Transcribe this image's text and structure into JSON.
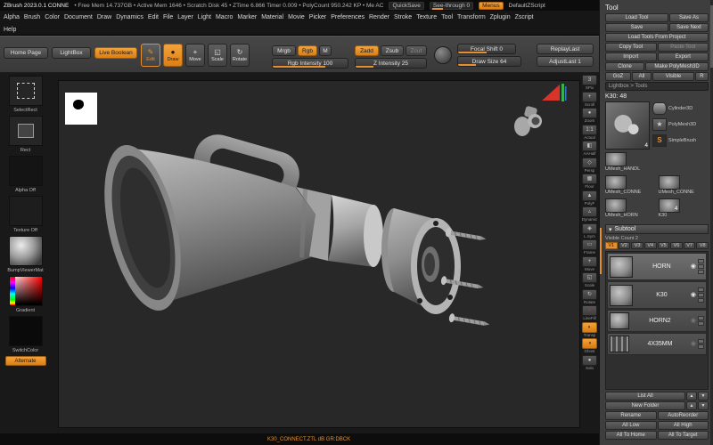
{
  "colors": {
    "accent": "#e78f2e",
    "canvas": "#282828",
    "panel": "#3e3e3e"
  },
  "icons": {
    "eye": "◉",
    "collapse": "▾"
  },
  "title_bar": {
    "app_title": "ZBrush 2023.0.1 CONNE",
    "stats": "• Free Mem 14.737GB • Active Mem 1646 • Scratch Disk 45 • ZTime 6.866 Timer 0.009 • PolyCount 950.242 KP • Me AC",
    "quicksave": "QuickSave",
    "see_through": "See-through 0",
    "menus_button": "Menus",
    "default_zscript": "DefaultZScript"
  },
  "menu_bar": {
    "items": [
      "Alpha",
      "Brush",
      "Color",
      "Document",
      "Draw",
      "Dynamics",
      "Edit",
      "File",
      "Layer",
      "Light",
      "Macro",
      "Marker",
      "Material",
      "Movie",
      "Picker",
      "Preferences",
      "Render",
      "Stroke",
      "Texture",
      "Tool",
      "Transform",
      "Zplugin",
      "Zscript"
    ],
    "help": "Help"
  },
  "shelf": {
    "home_page": "Home Page",
    "lightbox": "LightBox",
    "live_boolean": "Live Boolean",
    "modes": [
      {
        "label": "Edit",
        "glyph": "✎"
      },
      {
        "label": "Draw",
        "glyph": "●"
      },
      {
        "label": "Move",
        "glyph": "+"
      },
      {
        "label": "Scale",
        "glyph": "◱"
      },
      {
        "label": "Rotate",
        "glyph": "↻"
      }
    ],
    "mrgb": "Mrgb",
    "rgb": "Rgb",
    "m": "M",
    "rgb_intensity": "Rgb Intensity 100",
    "zadd": "Zadd",
    "zsub": "Zsub",
    "zcut": "Zcut",
    "z_intensity": "Z Intensity 25",
    "focal_shift": "Focal Shift 0",
    "draw_size": "Draw Size 64",
    "replay_last": "ReplayLast",
    "adjust_last": "AdjustLast 1"
  },
  "left_tray": {
    "selectrect": "SelectRect",
    "rect": "Rect",
    "alpha_off": "Alpha Off",
    "texture_off": "Texture Off",
    "material": "BumpViewerMat",
    "gradient": "Gradient",
    "switch_color": "SwitchColor",
    "alternate": "Alternate"
  },
  "right_shelf": {
    "items": [
      {
        "label": "SPix",
        "glyph": "3"
      },
      {
        "label": "Scroll",
        "glyph": "+"
      },
      {
        "label": "Zoom",
        "glyph": "●"
      },
      {
        "label": "Actual",
        "glyph": "1:1"
      },
      {
        "label": "AAHalf",
        "glyph": "◧"
      },
      {
        "label": "Persp",
        "glyph": "◇"
      },
      {
        "label": "Floor",
        "glyph": "▦"
      },
      {
        "label": "PolyF",
        "glyph": "▲"
      },
      {
        "label": "Dynamic",
        "glyph": "▵"
      },
      {
        "label": "L.Sym",
        "glyph": "◈"
      },
      {
        "label": "Frame",
        "glyph": "▭"
      },
      {
        "label": "Move",
        "glyph": "+"
      },
      {
        "label": "Scale",
        "glyph": "◱"
      },
      {
        "label": "Rotate",
        "glyph": "↻"
      },
      {
        "label": "LineFill",
        "glyph": "○"
      },
      {
        "label": "Transp",
        "glyph": "◐"
      },
      {
        "label": "Ghost",
        "glyph": "◑"
      },
      {
        "label": "Solo",
        "glyph": "●"
      }
    ]
  },
  "tool_panel": {
    "title": "Tool",
    "load_tool": "Load Tool",
    "save_as": "Save As",
    "save": "Save",
    "save_next": "Save Next",
    "load_from_project": "Load Tools From Project",
    "copy_tool": "Copy Tool",
    "paste_tool": "Paste Tool",
    "import": "Import",
    "export": "Export",
    "clone": "Clone",
    "make_polymesh": "Make PolyMesh3D",
    "goz": "GoZ",
    "all": "All",
    "visible": "Visible",
    "r": "R",
    "lightbox_tools": "Lightbox > Tools",
    "active_tool": "K30: 48",
    "active_badge": "4",
    "recent": [
      {
        "label": "Cylinder3D",
        "glyph": ""
      },
      {
        "label": "PolyMesh3D",
        "glyph": "★"
      },
      {
        "label": "SimpleBrush",
        "glyph": "S"
      },
      {
        "label": "UMesh_HANDL"
      },
      {
        "label": "UMesh_CONNE"
      },
      {
        "label": "UMesh_CONNE"
      },
      {
        "label": "UMesh_HORN"
      },
      {
        "label": "K30",
        "badge": "4"
      }
    ]
  },
  "subtool": {
    "title": "Subtool",
    "visible_count": "Visible Count 2",
    "tabs": [
      "V1",
      "V2",
      "V3",
      "V4",
      "V5",
      "V6",
      "V7",
      "V8"
    ],
    "items": [
      {
        "name": "HORN"
      },
      {
        "name": "K30"
      },
      {
        "name": "HORN2"
      },
      {
        "name": "4X35MM"
      }
    ],
    "list_all": "List All",
    "new_folder": "New Folder",
    "up": "▲",
    "down": "▼",
    "rename": "Rename",
    "autoreorder": "AutoReorder",
    "all_low": "All Low",
    "all_high": "All High",
    "all_to_home": "All To Home",
    "all_to_target": "All To Target"
  },
  "bottom_bar": {
    "note": "K30_CONNECT.ZTL  dB GR:DBCK"
  }
}
